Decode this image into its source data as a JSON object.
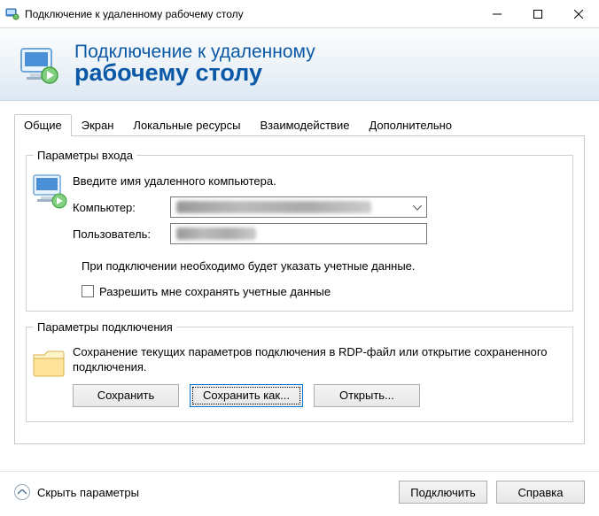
{
  "titlebar": {
    "title": "Подключение к удаленному рабочему столу"
  },
  "header": {
    "line1": "Подключение к удаленному",
    "line2": "рабочему столу"
  },
  "tabs": [
    "Общие",
    "Экран",
    "Локальные ресурсы",
    "Взаимодействие",
    "Дополнительно"
  ],
  "login": {
    "legend": "Параметры входа",
    "intro": "Введите имя удаленного компьютера.",
    "computer_label": "Компьютер:",
    "computer_value": "",
    "user_label": "Пользователь:",
    "user_value": "",
    "note": "При подключении необходимо будет указать учетные данные.",
    "save_creds": "Разрешить мне сохранять учетные данные"
  },
  "conn": {
    "legend": "Параметры подключения",
    "desc": "Сохранение текущих параметров подключения в RDP-файл или открытие сохраненного подключения.",
    "save": "Сохранить",
    "save_as": "Сохранить как...",
    "open": "Открыть..."
  },
  "footer": {
    "hide": "Скрыть параметры",
    "connect": "Подключить",
    "help": "Справка"
  }
}
